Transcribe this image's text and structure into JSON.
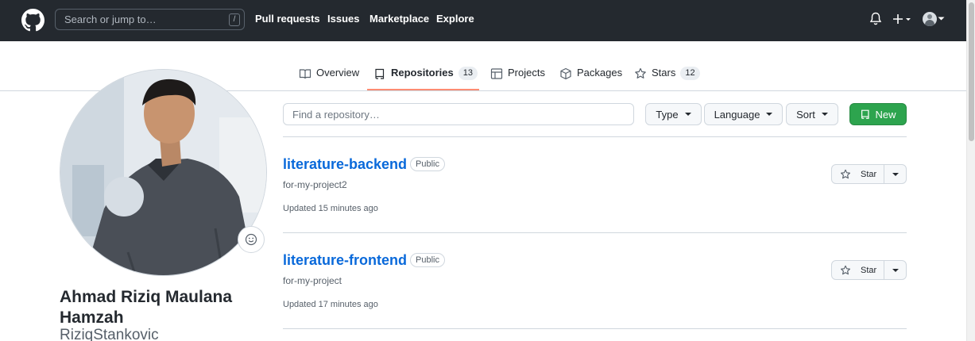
{
  "header": {
    "search_placeholder": "Search or jump to…",
    "search_shortcut": "/",
    "nav": [
      "Pull requests",
      "Issues",
      "Marketplace",
      "Explore"
    ]
  },
  "tabs": [
    {
      "label": "Overview",
      "icon": "book-icon"
    },
    {
      "label": "Repositories",
      "count": "13",
      "icon": "repo-icon",
      "active": true
    },
    {
      "label": "Projects",
      "icon": "table-icon"
    },
    {
      "label": "Packages",
      "icon": "package-icon"
    },
    {
      "label": "Stars",
      "count": "12",
      "icon": "star-icon"
    }
  ],
  "profile": {
    "fullname": "Ahmad Riziq Maulana Hamzah",
    "username": "RiziqStankovic"
  },
  "filters": {
    "find_placeholder": "Find a repository…",
    "type": "Type",
    "language": "Language",
    "sort": "Sort",
    "new": "New"
  },
  "repos": [
    {
      "name": "literature-backend",
      "visibility": "Public",
      "description": "for-my-project2",
      "updated": "Updated 15 minutes ago",
      "star_label": "Star"
    },
    {
      "name": "literature-frontend",
      "visibility": "Public",
      "description": "for-my-project",
      "updated": "Updated 17 minutes ago",
      "star_label": "Star"
    }
  ],
  "colors": {
    "header_bg": "#24292f",
    "link": "#0969da",
    "new_button": "#2da44e",
    "tab_underline": "#fd8c73"
  }
}
